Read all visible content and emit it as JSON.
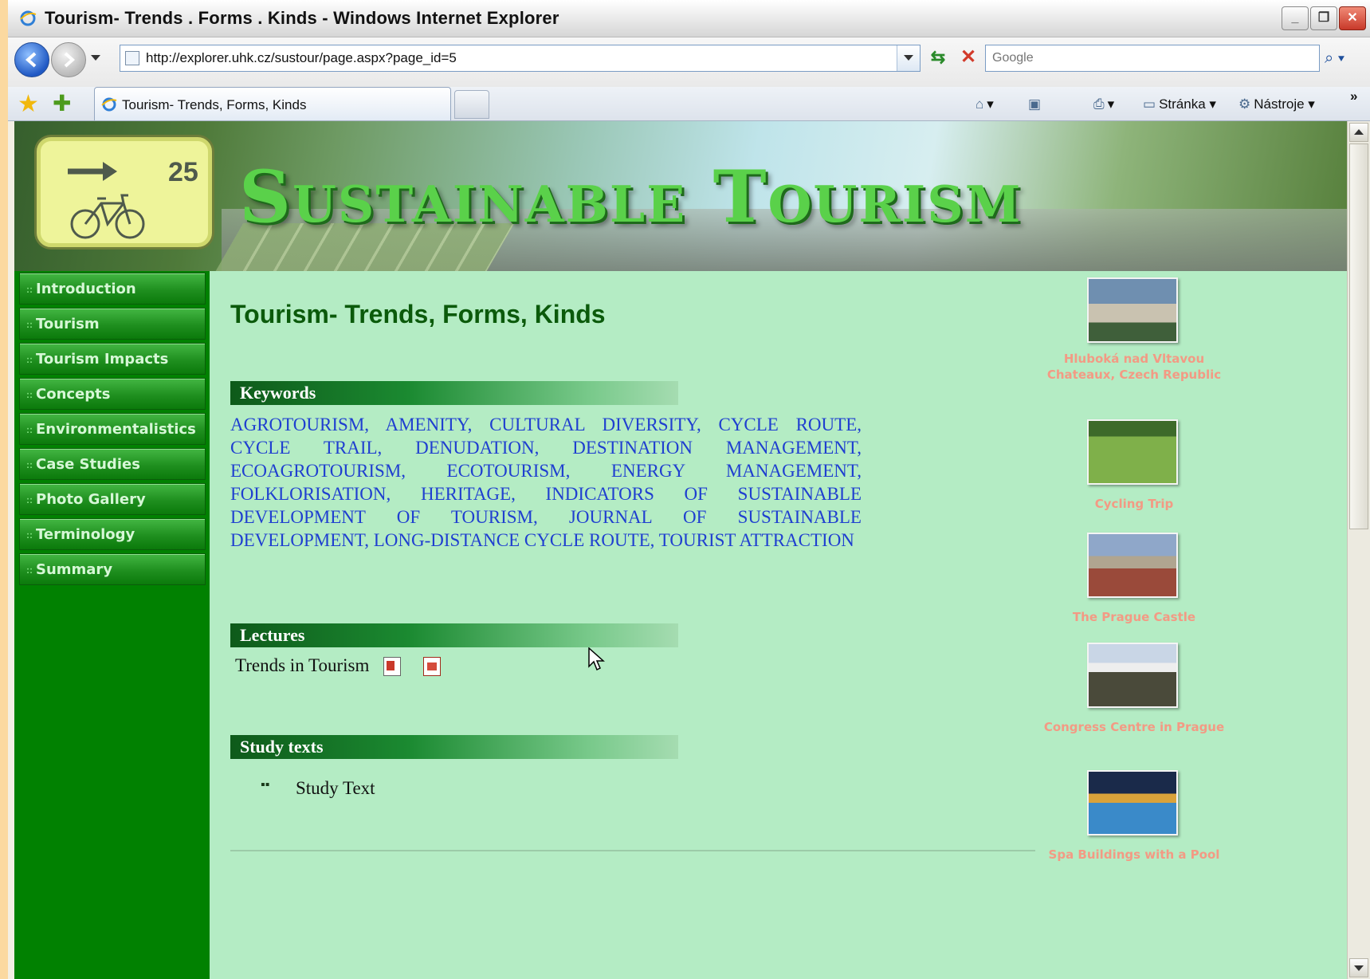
{
  "window": {
    "title": "Tourism- Trends . Forms . Kinds - Windows Internet Explorer",
    "minimize": "_",
    "restore": "❐",
    "close": "✕"
  },
  "address": {
    "url": "http://explorer.uhk.cz/sustour/page.aspx?page_id=5",
    "search_placeholder": "Google"
  },
  "tabbar": {
    "tab_label": "Tourism- Trends, Forms, Kinds",
    "tools": [
      "Stránka",
      "Nástroje"
    ]
  },
  "banner": {
    "title": "Sustainable Tourism",
    "sign_number": "25"
  },
  "sidebar": {
    "items": [
      {
        "label": "Introduction"
      },
      {
        "label": "Tourism"
      },
      {
        "label": "Tourism Impacts"
      },
      {
        "label": "Concepts"
      },
      {
        "label": "Environmentalistics"
      },
      {
        "label": "Case Studies"
      },
      {
        "label": "Photo Gallery"
      },
      {
        "label": "Terminology"
      },
      {
        "label": "Summary"
      }
    ]
  },
  "main": {
    "page_title": "Tourism- Trends, Forms, Kinds",
    "keywords_heading": "Keywords",
    "keywords_text": "AGROTOURISM, AMENITY, CULTURAL DIVERSITY, CYCLE ROUTE, CYCLE TRAIL, DENUDATION, DESTINATION MANAGEMENT, ECOAGROTOURISM, ECOTOURISM, ENERGY MANAGEMENT, FOLKLORISATION, HERITAGE, INDICATORS OF SUSTAINABLE DEVELOPMENT OF TOURISM, JOURNAL OF SUSTAINABLE DEVELOPMENT, LONG-DISTANCE CYCLE ROUTE, TOURIST ATTRACTION",
    "lectures_heading": "Lectures",
    "lecture_item": "Trends in Tourism",
    "study_heading": "Study texts",
    "study_item": "Study Text"
  },
  "gallery": {
    "items": [
      {
        "caption": "Hluboká nad Vltavou Chateaux, Czech Republic",
        "colors": [
          "#6f8fb0",
          "#3f5f3a"
        ]
      },
      {
        "caption": "Cycling Trip",
        "colors": [
          "#3d6a2a",
          "#7fb04a"
        ]
      },
      {
        "caption": "The Prague Castle",
        "colors": [
          "#8fa7c9",
          "#9a4a3a"
        ]
      },
      {
        "caption": "Congress Centre in Prague",
        "colors": [
          "#c9d6e6",
          "#4a4a3a"
        ]
      },
      {
        "caption": "Spa Buildings with a Pool",
        "colors": [
          "#1a2a4a",
          "#3a8ac9"
        ]
      }
    ]
  },
  "colors": {
    "page_bg": "#b4ecc4",
    "sidebar_bg": "#018101",
    "keyword_link": "#1f3fd0",
    "caption": "#f39a84"
  }
}
